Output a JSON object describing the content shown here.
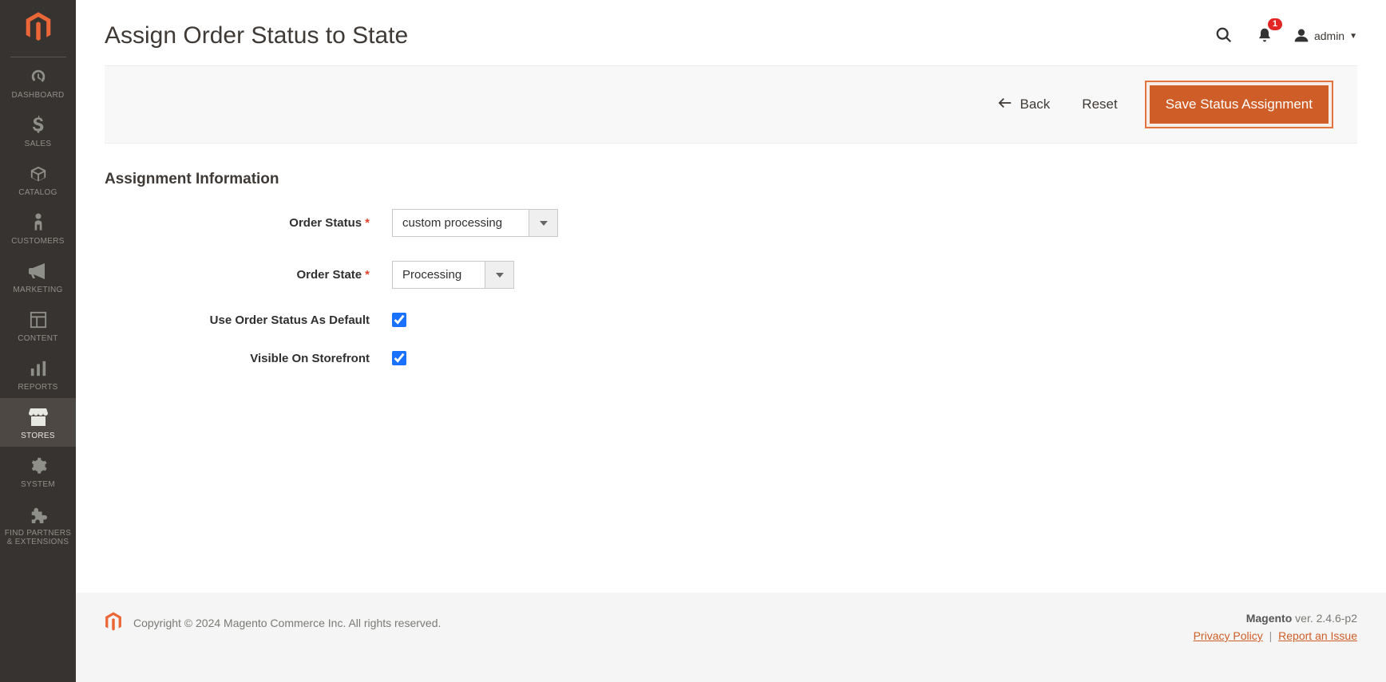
{
  "sidebar": {
    "items": [
      {
        "label": "DASHBOARD"
      },
      {
        "label": "SALES"
      },
      {
        "label": "CATALOG"
      },
      {
        "label": "CUSTOMERS"
      },
      {
        "label": "MARKETING"
      },
      {
        "label": "CONTENT"
      },
      {
        "label": "REPORTS"
      },
      {
        "label": "STORES"
      },
      {
        "label": "SYSTEM"
      },
      {
        "label": "FIND PARTNERS\n& EXTENSIONS"
      }
    ]
  },
  "header": {
    "title": "Assign Order Status to State",
    "notification_count": "1",
    "user_label": "admin"
  },
  "actions": {
    "back": "Back",
    "reset": "Reset",
    "save": "Save Status Assignment"
  },
  "form": {
    "section_title": "Assignment Information",
    "order_status_label": "Order Status",
    "order_status_value": "custom processing",
    "order_state_label": "Order State",
    "order_state_value": "Processing",
    "default_label": "Use Order Status As Default",
    "default_checked": true,
    "visible_label": "Visible On Storefront",
    "visible_checked": true
  },
  "footer": {
    "copyright": "Copyright © 2024 Magento Commerce Inc. All rights reserved.",
    "version_prefix": "Magento",
    "version_text": " ver. 2.4.6-p2",
    "privacy": "Privacy Policy",
    "report": "Report an Issue"
  }
}
